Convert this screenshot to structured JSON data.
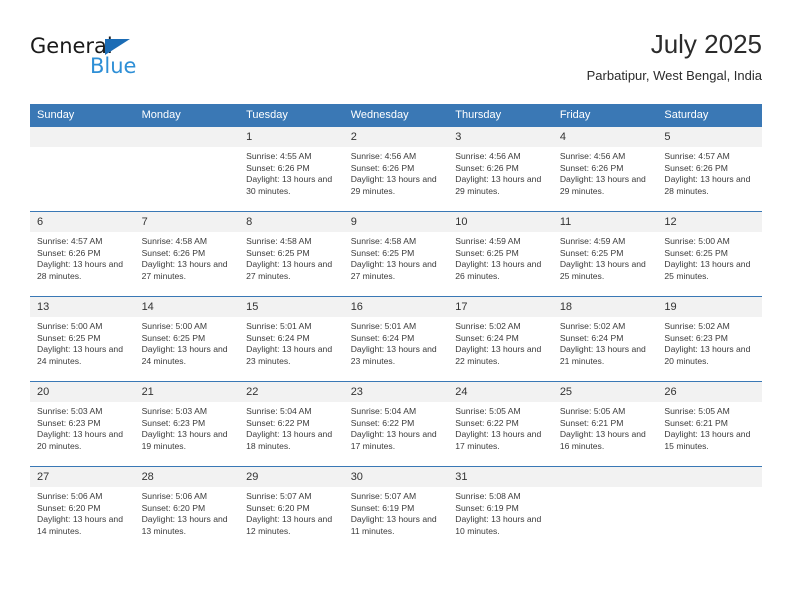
{
  "brand": {
    "name_top": "General",
    "name_bottom": "Blue"
  },
  "header": {
    "title": "July 2025",
    "subtitle": "Parbatipur, West Bengal, India"
  },
  "colors": {
    "header_blue": "#3a78b5",
    "brand_blue": "#2e8fd6",
    "triangle_blue": "#1b6cb5",
    "daynum_bg": "#f2f2f2"
  },
  "weekdays": [
    "Sunday",
    "Monday",
    "Tuesday",
    "Wednesday",
    "Thursday",
    "Friday",
    "Saturday"
  ],
  "labels": {
    "sunrise": "Sunrise:",
    "sunset": "Sunset:",
    "daylight": "Daylight:"
  },
  "weeks": [
    [
      {
        "day": "",
        "sunrise": "",
        "sunset": "",
        "daylight": ""
      },
      {
        "day": "",
        "sunrise": "",
        "sunset": "",
        "daylight": ""
      },
      {
        "day": "1",
        "sunrise": "Sunrise: 4:55 AM",
        "sunset": "Sunset: 6:26 PM",
        "daylight": "Daylight: 13 hours and 30 minutes."
      },
      {
        "day": "2",
        "sunrise": "Sunrise: 4:56 AM",
        "sunset": "Sunset: 6:26 PM",
        "daylight": "Daylight: 13 hours and 29 minutes."
      },
      {
        "day": "3",
        "sunrise": "Sunrise: 4:56 AM",
        "sunset": "Sunset: 6:26 PM",
        "daylight": "Daylight: 13 hours and 29 minutes."
      },
      {
        "day": "4",
        "sunrise": "Sunrise: 4:56 AM",
        "sunset": "Sunset: 6:26 PM",
        "daylight": "Daylight: 13 hours and 29 minutes."
      },
      {
        "day": "5",
        "sunrise": "Sunrise: 4:57 AM",
        "sunset": "Sunset: 6:26 PM",
        "daylight": "Daylight: 13 hours and 28 minutes."
      }
    ],
    [
      {
        "day": "6",
        "sunrise": "Sunrise: 4:57 AM",
        "sunset": "Sunset: 6:26 PM",
        "daylight": "Daylight: 13 hours and 28 minutes."
      },
      {
        "day": "7",
        "sunrise": "Sunrise: 4:58 AM",
        "sunset": "Sunset: 6:26 PM",
        "daylight": "Daylight: 13 hours and 27 minutes."
      },
      {
        "day": "8",
        "sunrise": "Sunrise: 4:58 AM",
        "sunset": "Sunset: 6:25 PM",
        "daylight": "Daylight: 13 hours and 27 minutes."
      },
      {
        "day": "9",
        "sunrise": "Sunrise: 4:58 AM",
        "sunset": "Sunset: 6:25 PM",
        "daylight": "Daylight: 13 hours and 27 minutes."
      },
      {
        "day": "10",
        "sunrise": "Sunrise: 4:59 AM",
        "sunset": "Sunset: 6:25 PM",
        "daylight": "Daylight: 13 hours and 26 minutes."
      },
      {
        "day": "11",
        "sunrise": "Sunrise: 4:59 AM",
        "sunset": "Sunset: 6:25 PM",
        "daylight": "Daylight: 13 hours and 25 minutes."
      },
      {
        "day": "12",
        "sunrise": "Sunrise: 5:00 AM",
        "sunset": "Sunset: 6:25 PM",
        "daylight": "Daylight: 13 hours and 25 minutes."
      }
    ],
    [
      {
        "day": "13",
        "sunrise": "Sunrise: 5:00 AM",
        "sunset": "Sunset: 6:25 PM",
        "daylight": "Daylight: 13 hours and 24 minutes."
      },
      {
        "day": "14",
        "sunrise": "Sunrise: 5:00 AM",
        "sunset": "Sunset: 6:25 PM",
        "daylight": "Daylight: 13 hours and 24 minutes."
      },
      {
        "day": "15",
        "sunrise": "Sunrise: 5:01 AM",
        "sunset": "Sunset: 6:24 PM",
        "daylight": "Daylight: 13 hours and 23 minutes."
      },
      {
        "day": "16",
        "sunrise": "Sunrise: 5:01 AM",
        "sunset": "Sunset: 6:24 PM",
        "daylight": "Daylight: 13 hours and 23 minutes."
      },
      {
        "day": "17",
        "sunrise": "Sunrise: 5:02 AM",
        "sunset": "Sunset: 6:24 PM",
        "daylight": "Daylight: 13 hours and 22 minutes."
      },
      {
        "day": "18",
        "sunrise": "Sunrise: 5:02 AM",
        "sunset": "Sunset: 6:24 PM",
        "daylight": "Daylight: 13 hours and 21 minutes."
      },
      {
        "day": "19",
        "sunrise": "Sunrise: 5:02 AM",
        "sunset": "Sunset: 6:23 PM",
        "daylight": "Daylight: 13 hours and 20 minutes."
      }
    ],
    [
      {
        "day": "20",
        "sunrise": "Sunrise: 5:03 AM",
        "sunset": "Sunset: 6:23 PM",
        "daylight": "Daylight: 13 hours and 20 minutes."
      },
      {
        "day": "21",
        "sunrise": "Sunrise: 5:03 AM",
        "sunset": "Sunset: 6:23 PM",
        "daylight": "Daylight: 13 hours and 19 minutes."
      },
      {
        "day": "22",
        "sunrise": "Sunrise: 5:04 AM",
        "sunset": "Sunset: 6:22 PM",
        "daylight": "Daylight: 13 hours and 18 minutes."
      },
      {
        "day": "23",
        "sunrise": "Sunrise: 5:04 AM",
        "sunset": "Sunset: 6:22 PM",
        "daylight": "Daylight: 13 hours and 17 minutes."
      },
      {
        "day": "24",
        "sunrise": "Sunrise: 5:05 AM",
        "sunset": "Sunset: 6:22 PM",
        "daylight": "Daylight: 13 hours and 17 minutes."
      },
      {
        "day": "25",
        "sunrise": "Sunrise: 5:05 AM",
        "sunset": "Sunset: 6:21 PM",
        "daylight": "Daylight: 13 hours and 16 minutes."
      },
      {
        "day": "26",
        "sunrise": "Sunrise: 5:05 AM",
        "sunset": "Sunset: 6:21 PM",
        "daylight": "Daylight: 13 hours and 15 minutes."
      }
    ],
    [
      {
        "day": "27",
        "sunrise": "Sunrise: 5:06 AM",
        "sunset": "Sunset: 6:20 PM",
        "daylight": "Daylight: 13 hours and 14 minutes."
      },
      {
        "day": "28",
        "sunrise": "Sunrise: 5:06 AM",
        "sunset": "Sunset: 6:20 PM",
        "daylight": "Daylight: 13 hours and 13 minutes."
      },
      {
        "day": "29",
        "sunrise": "Sunrise: 5:07 AM",
        "sunset": "Sunset: 6:20 PM",
        "daylight": "Daylight: 13 hours and 12 minutes."
      },
      {
        "day": "30",
        "sunrise": "Sunrise: 5:07 AM",
        "sunset": "Sunset: 6:19 PM",
        "daylight": "Daylight: 13 hours and 11 minutes."
      },
      {
        "day": "31",
        "sunrise": "Sunrise: 5:08 AM",
        "sunset": "Sunset: 6:19 PM",
        "daylight": "Daylight: 13 hours and 10 minutes."
      },
      {
        "day": "",
        "sunrise": "",
        "sunset": "",
        "daylight": ""
      },
      {
        "day": "",
        "sunrise": "",
        "sunset": "",
        "daylight": ""
      }
    ]
  ]
}
